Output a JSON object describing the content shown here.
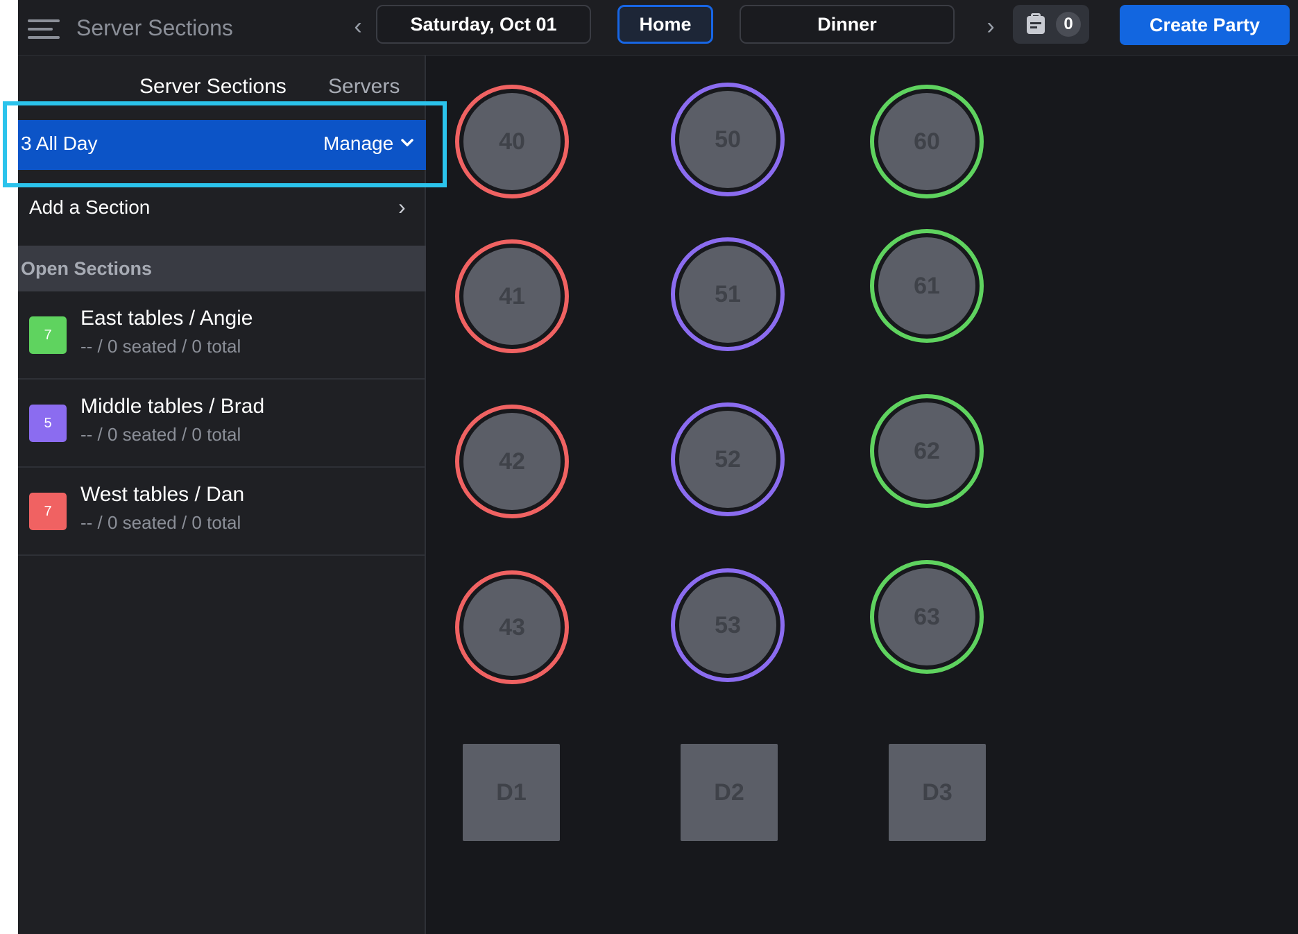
{
  "header": {
    "title": "Server Sections",
    "date": "Saturday, Oct 01",
    "home_label": "Home",
    "meal": "Dinner",
    "notification_count": "0",
    "create_label": "Create Party"
  },
  "sidebar": {
    "tabs": [
      "Server Sections",
      "Servers"
    ],
    "shift": {
      "label": "3 All Day",
      "manage_label": "Manage"
    },
    "add_section_label": "Add a Section",
    "open_sections_label": "Open Sections",
    "sections": [
      {
        "count": "7",
        "color": "#5fd35f",
        "name": "East tables / Angie",
        "stats": "-- / 0 seated / 0 total"
      },
      {
        "count": "5",
        "color": "#8b6cf0",
        "name": "Middle tables / Brad",
        "stats": "-- / 0 seated / 0 total"
      },
      {
        "count": "7",
        "color": "#f06262",
        "name": "West tables / Dan",
        "stats": "-- / 0 seated / 0 total"
      }
    ]
  },
  "floor": {
    "tables": {
      "t40": "40",
      "t41": "41",
      "t42": "42",
      "t43": "43",
      "t50": "50",
      "t51": "51",
      "t52": "52",
      "t53": "53",
      "t60": "60",
      "t61": "61",
      "t62": "62",
      "t63": "63",
      "d1": "D1",
      "d2": "D2",
      "d3": "D3"
    }
  },
  "colors": {
    "accent": "#1266e0",
    "highlight": "#2bc3ec",
    "west": "#f06262",
    "middle": "#8b6cf0",
    "east": "#5fd35f"
  }
}
